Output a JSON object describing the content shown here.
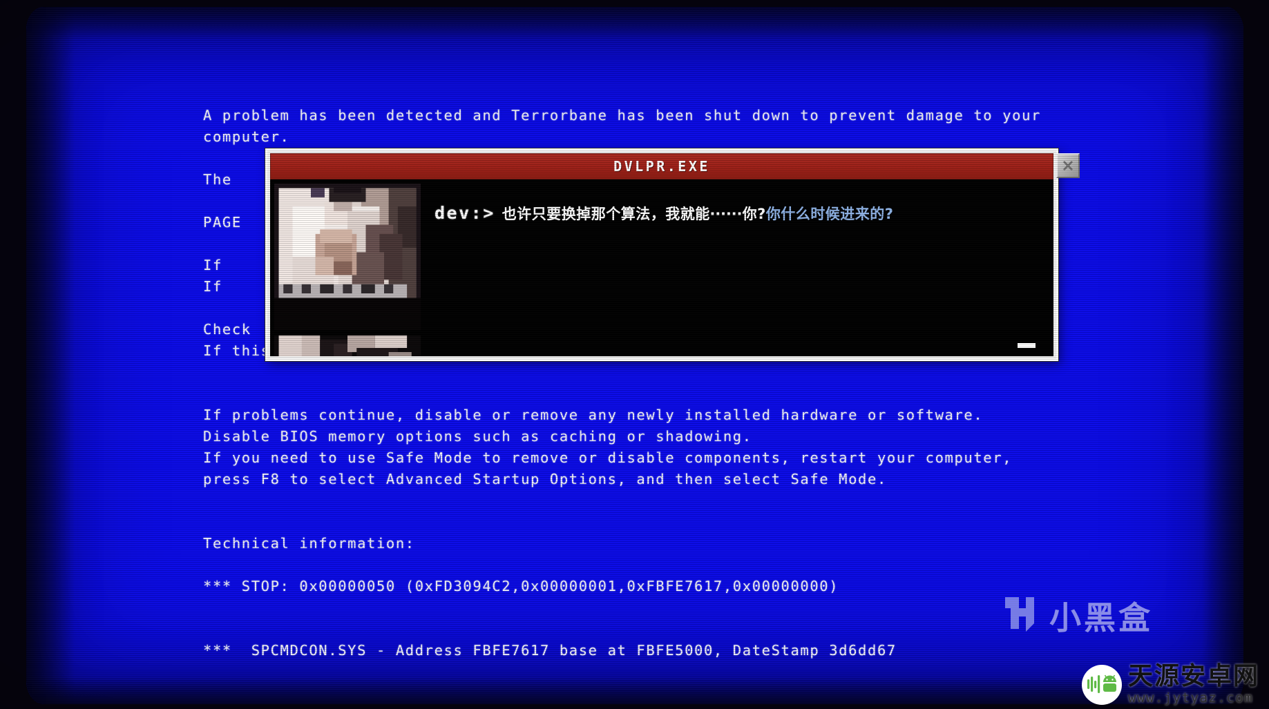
{
  "screen": {
    "background_color": "#0a0ae8",
    "text_color": "#f2f2f8"
  },
  "bsod": {
    "lines": [
      "A problem has been detected and Terrorbane has been shut down to prevent damage to your",
      "computer.",
      "",
      "The",
      "",
      "PAGE",
      "",
      "If",
      "If",
      "",
      "Check",
      "If this is a new installation, ask your hardware or software manufacturer for updates.",
      "",
      "",
      "If problems continue, disable or remove any newly installed hardware or software.",
      "Disable BIOS memory options such as caching or shadowing.",
      "If you need to use Safe Mode to remove or disable components, restart your computer,",
      "press F8 to select Advanced Startup Options, and then select Safe Mode.",
      "",
      "",
      "Technical information:",
      "",
      "*** STOP: 0x00000050 (0xFD3094C2,0x00000001,0xFBFE7617,0x00000000)",
      "",
      "",
      "***  SPCMDCON.SYS - Address FBFE7617 base at FBFE5000, DateStamp 3d6dd67"
    ],
    "occluded_tail": "."
  },
  "dialog": {
    "title": "DVLPR.EXE",
    "titlebar_color": "#9c1f16",
    "close_icon": "close-x-icon",
    "body_background": "#000000",
    "prompt": "dev:>",
    "message_main": "也许只要换掉那个算法，我就能‧‧‧‧‧‧你?",
    "message_alt": "你什么时候进来的?",
    "message_alt_color": "#8fb4e8",
    "continue_indicator": "—",
    "portrait_alt": "pixelated photo of a person in a white shirt with hands clasped over a keyboard"
  },
  "watermarks": {
    "xiaoheihe": {
      "label": "小黑盒",
      "logo_icon": "xiaoheihe-logo-icon",
      "color": "#d9dcf7"
    },
    "tianyuan": {
      "label": "天源安卓网",
      "url": "www.jytyaz.com",
      "logo_icon": "android-robot-icon",
      "logo_color": "#5fba46"
    }
  }
}
